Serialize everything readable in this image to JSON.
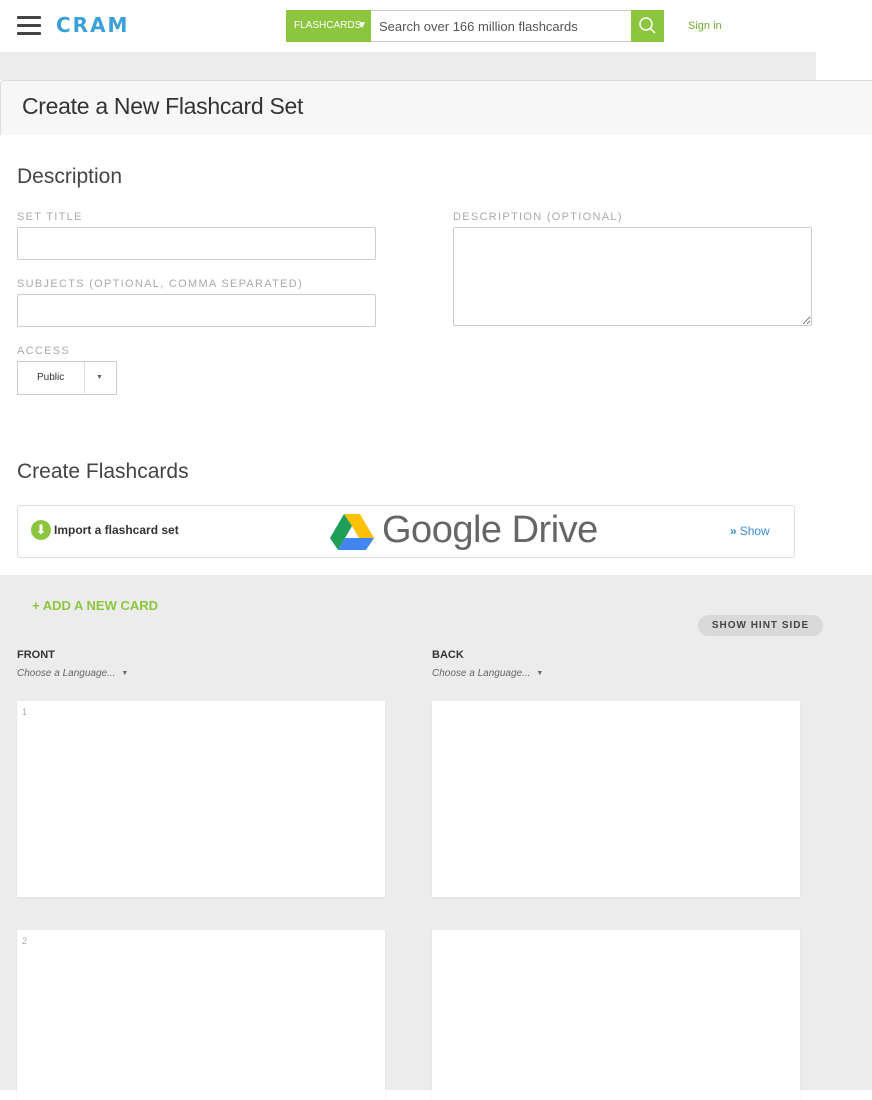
{
  "header": {
    "logo": "CRAM",
    "search_category": "FLASHCARDS",
    "search_placeholder": "Search over 166 million flashcards",
    "signin": "Sign in"
  },
  "page": {
    "title": "Create a New Flashcard Set"
  },
  "description": {
    "heading": "Description",
    "set_title_label": "SET TITLE",
    "subjects_label": "SUBJECTS (OPTIONAL, COMMA SEPARATED)",
    "description_label": "DESCRIPTION (OPTIONAL)",
    "access_label": "ACCESS",
    "access_value": "Public"
  },
  "flashcards": {
    "heading": "Create Flashcards",
    "import_label": "Import a flashcard set",
    "google_drive": "Google Drive",
    "show_label": "Show",
    "add_card": "+ ADD A NEW CARD",
    "show_hint": "SHOW HINT SIDE",
    "front_label": "FRONT",
    "back_label": "BACK",
    "front_language": "Choose a Language...",
    "back_language": "Choose a Language...",
    "card_numbers": [
      "1",
      "2"
    ]
  },
  "colors": {
    "brand_green": "#8cc63f",
    "logo_blue": "#3aa0d8",
    "link_blue": "#3a8ed8"
  }
}
